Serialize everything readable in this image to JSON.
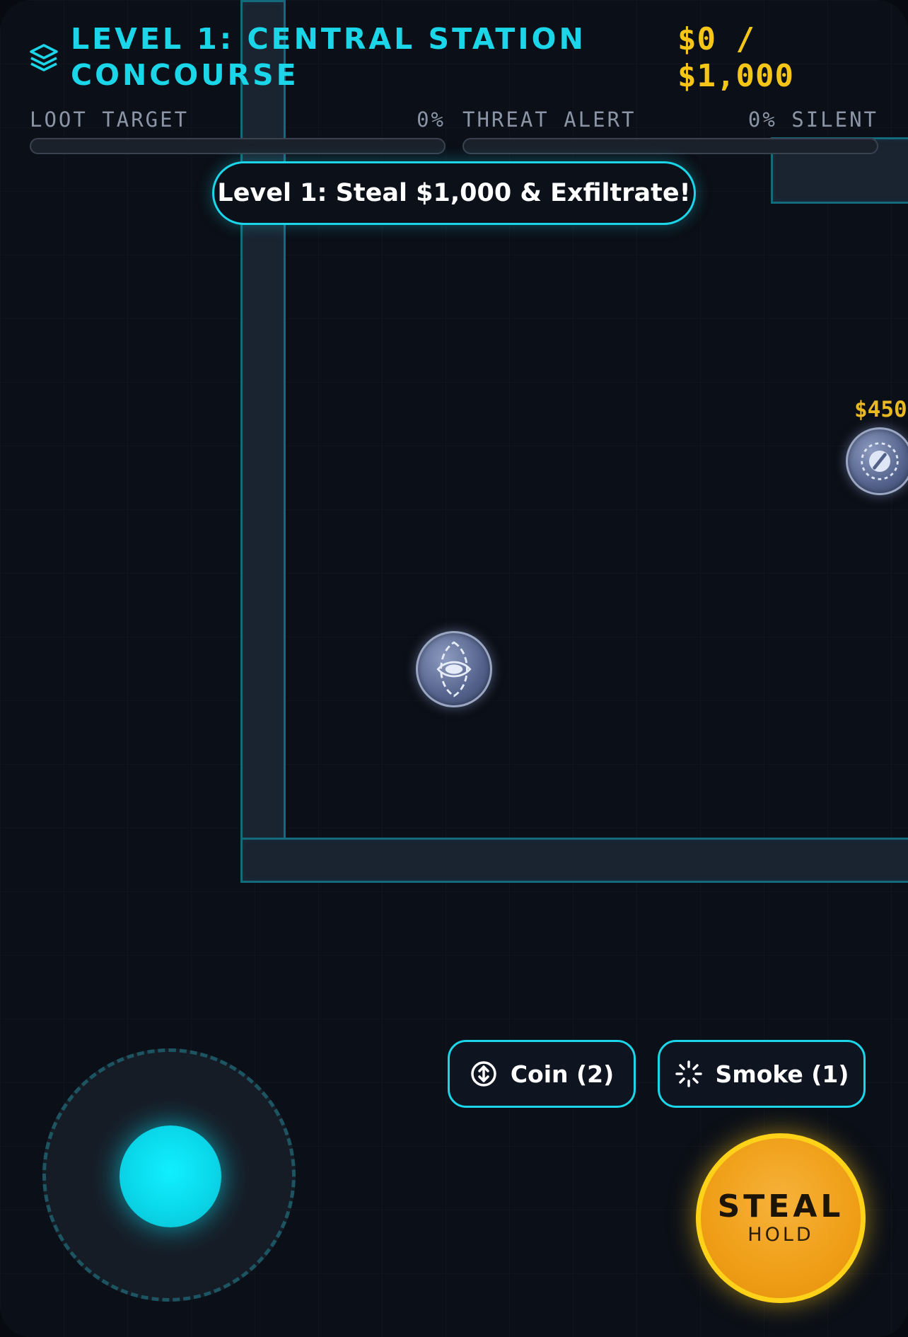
{
  "hud": {
    "level_title": "LEVEL 1: CENTRAL STATION CONCOURSE",
    "money": "$0 / $1,000",
    "loot_meter": {
      "label": "LOOT TARGET",
      "percent_text": "0%",
      "fill_fraction": 0,
      "color": "#1ad6e8"
    },
    "threat_meter": {
      "label": "THREAT ALERT",
      "percent_text": "0% SILENT",
      "fill_fraction": 0,
      "color": "#ff4a4a"
    },
    "level_icon": "layers-icon"
  },
  "objective_banner": "Level 1: Steal $1,000 & Exfiltrate!",
  "entities": {
    "loot_target": {
      "value_label": "$450",
      "icon": "compass-icon"
    },
    "guard": {
      "icon": "eye-icon"
    }
  },
  "controls": {
    "gadgets": [
      {
        "label": "Coin (2)",
        "icon": "coin-icon"
      },
      {
        "label": "Smoke (1)",
        "icon": "smoke-icon"
      }
    ],
    "steal_button": {
      "label": "STEAL",
      "sublabel": "HOLD"
    }
  },
  "colors": {
    "accent": "#1ad6e8",
    "money": "#f5c518",
    "steal": "#ef9e16",
    "background": "#0b0f17"
  }
}
